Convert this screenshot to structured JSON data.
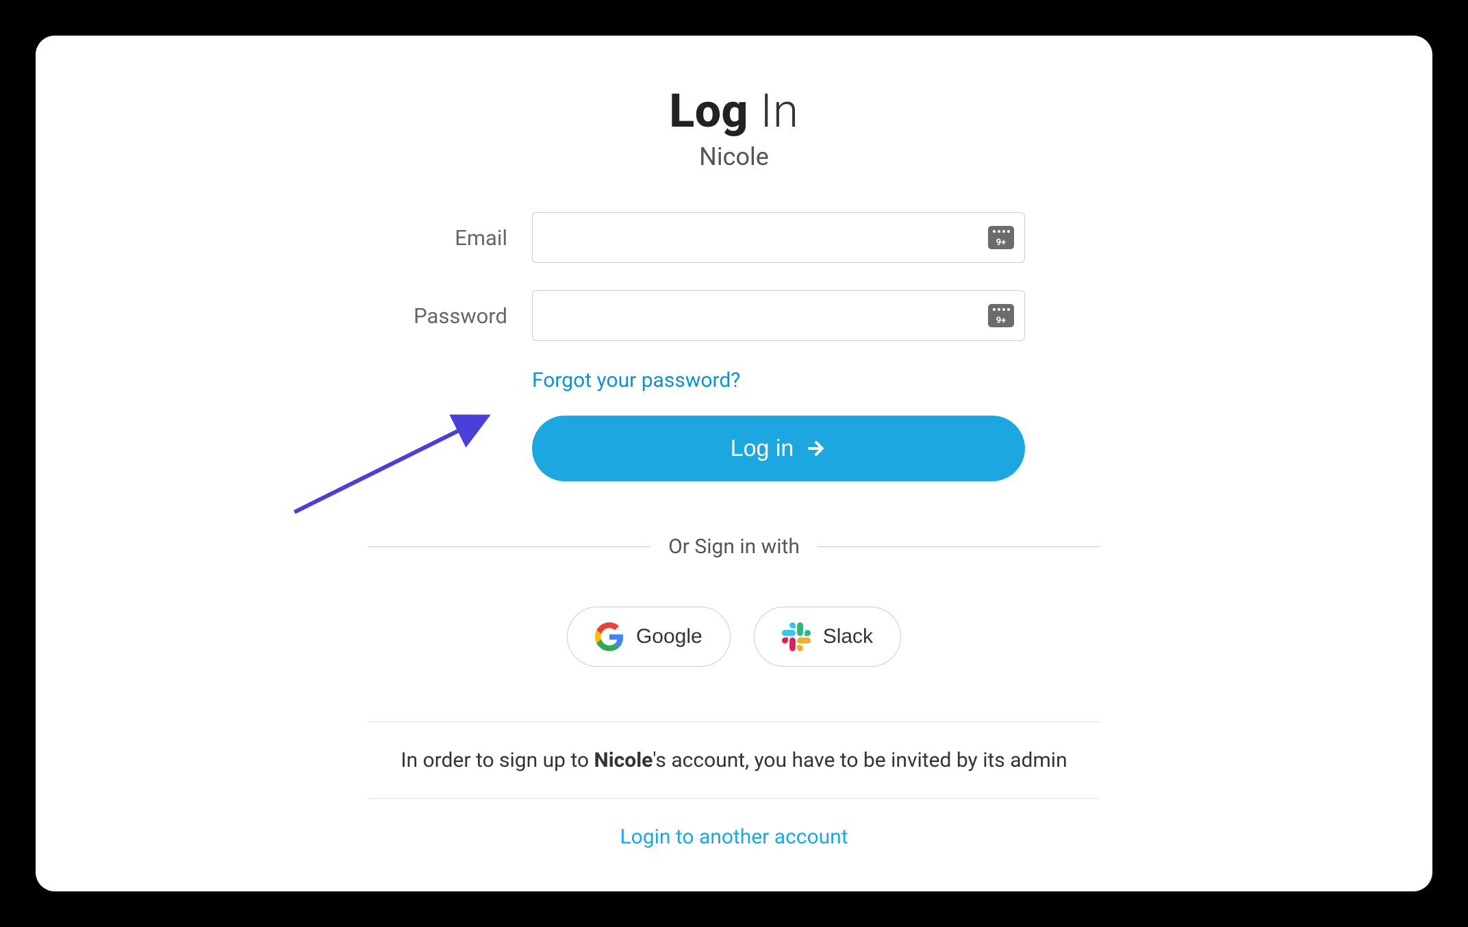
{
  "title": {
    "bold": "Log",
    "light": " In"
  },
  "subtitle": "Nicole",
  "form": {
    "email_label": "Email",
    "email_value": "",
    "password_label": "Password",
    "password_value": "",
    "input_badge_text": "9+"
  },
  "links": {
    "forgot": "Forgot your password?",
    "alt_login": "Login to another account"
  },
  "buttons": {
    "login": "Log in"
  },
  "divider": "Or Sign in with",
  "social": {
    "google": "Google",
    "slack": "Slack"
  },
  "info": {
    "pre": "In order to sign up to ",
    "bold": "Nicole",
    "post": "'s account, you have to be invited by its admin"
  }
}
